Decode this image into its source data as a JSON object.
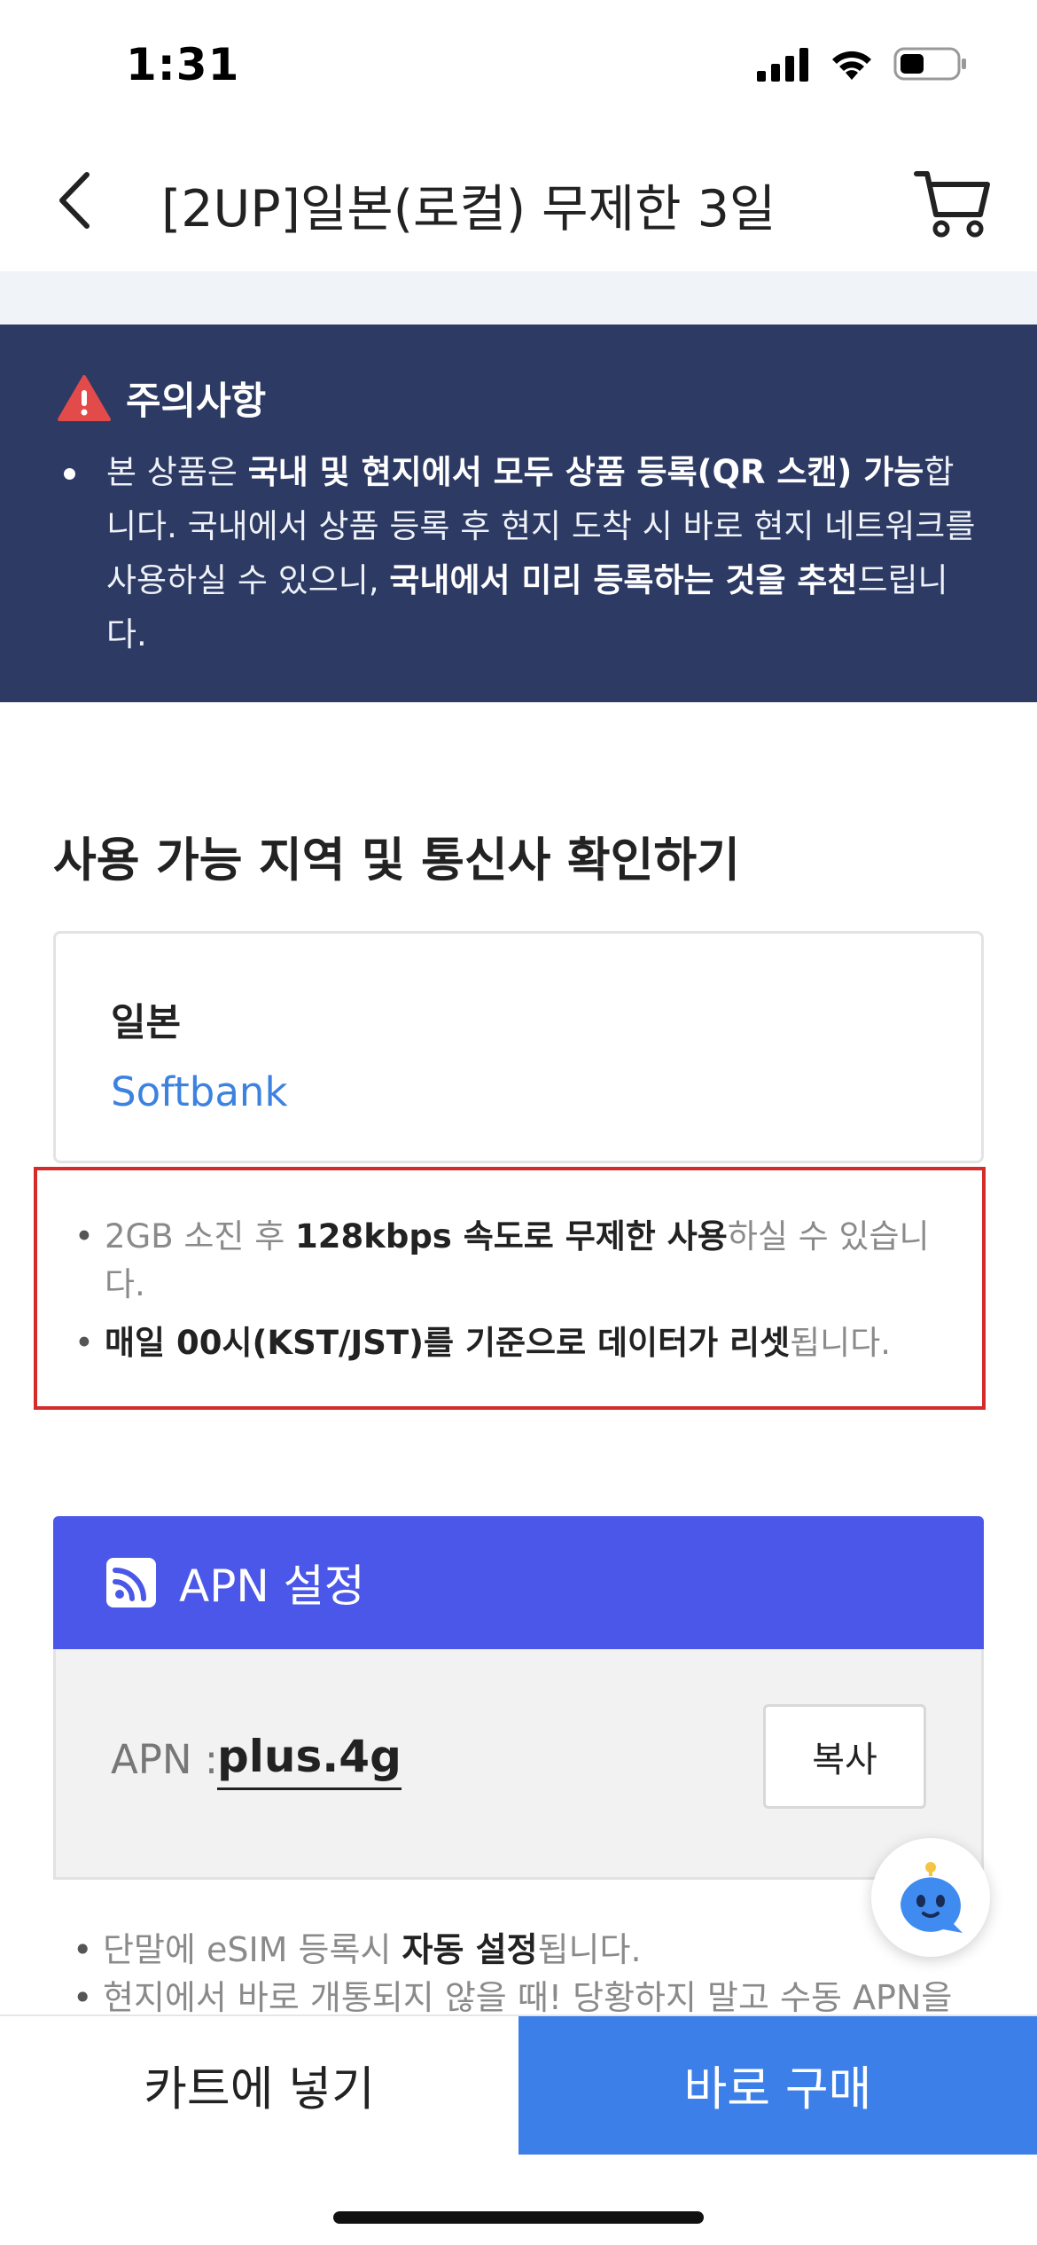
{
  "status_bar": {
    "time": "1:31"
  },
  "nav": {
    "title": "[2UP]일본(로컬) 무제한 3일"
  },
  "notice": {
    "title": "주의사항",
    "t1": "본 상품은 ",
    "b1": "국내 및 현지에서 모두 상품 등록(QR 스캔) 가능",
    "t2": "합니다. 국내에서 상품 등록 후 현지 도착 시 바로 현지 네트워크를 사용하실 수 있으니, ",
    "b2": "국내에서 미리 등록하는 것을 추천",
    "t3": "드립니다."
  },
  "coverage": {
    "section_title": "사용 가능 지역 및 통신사 확인하기",
    "country": "일본",
    "carrier": "Softbank"
  },
  "policy": {
    "bullet1_pre": "2GB 소진 후 ",
    "bullet1_bold": "128kbps 속도로 무제한 사용",
    "bullet1_post": "하실 수 있습니다.",
    "bullet2_bold": "매일 00시(KST/JST)를 기준으로 데이터가 리셋",
    "bullet2_post": "됩니다."
  },
  "apn": {
    "header": "APN 설정",
    "label": "APN :",
    "value": "plus.4g",
    "copy_label": "복사",
    "note1_pre": "단말에 eSIM 등록시 ",
    "note1_bold": "자동 설정",
    "note1_post": "됩니다.",
    "note2": "현지에서 바로 개통되지 않을 때! 당황하지 말고 수동 APN을"
  },
  "bottom": {
    "add_to_cart": "카트에 넣기",
    "buy_now": "바로 구매"
  },
  "colors": {
    "notice_bg": "#2c3a64",
    "apn_header_bg": "#4a57e8",
    "buy_button_bg": "#3d7fe8",
    "carrier_text": "#3d82e0",
    "highlight_border": "#d42b2b"
  },
  "icons": [
    "back-arrow-icon",
    "cart-icon",
    "warning-icon",
    "rss-icon",
    "chatbot-icon",
    "signal-icon",
    "wifi-icon",
    "battery-icon"
  ]
}
